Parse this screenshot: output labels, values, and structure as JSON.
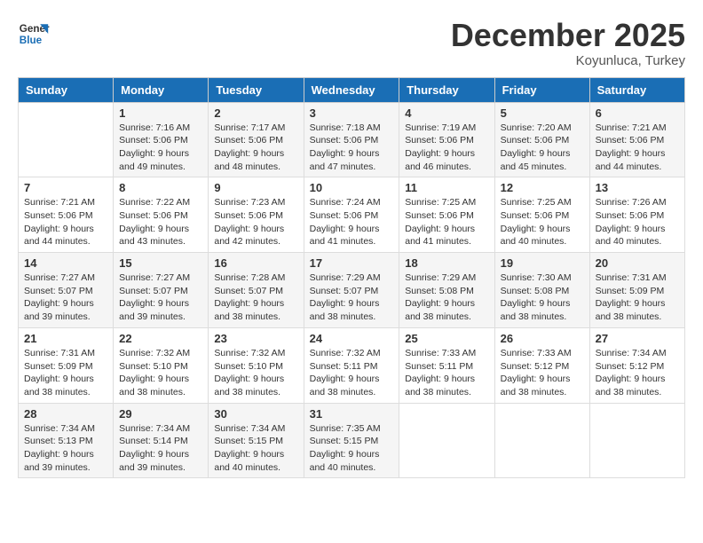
{
  "logo": {
    "line1": "General",
    "line2": "Blue"
  },
  "title": "December 2025",
  "subtitle": "Koyunluca, Turkey",
  "days_header": [
    "Sunday",
    "Monday",
    "Tuesday",
    "Wednesday",
    "Thursday",
    "Friday",
    "Saturday"
  ],
  "weeks": [
    [
      {
        "day": "",
        "info": ""
      },
      {
        "day": "1",
        "info": "Sunrise: 7:16 AM\nSunset: 5:06 PM\nDaylight: 9 hours\nand 49 minutes."
      },
      {
        "day": "2",
        "info": "Sunrise: 7:17 AM\nSunset: 5:06 PM\nDaylight: 9 hours\nand 48 minutes."
      },
      {
        "day": "3",
        "info": "Sunrise: 7:18 AM\nSunset: 5:06 PM\nDaylight: 9 hours\nand 47 minutes."
      },
      {
        "day": "4",
        "info": "Sunrise: 7:19 AM\nSunset: 5:06 PM\nDaylight: 9 hours\nand 46 minutes."
      },
      {
        "day": "5",
        "info": "Sunrise: 7:20 AM\nSunset: 5:06 PM\nDaylight: 9 hours\nand 45 minutes."
      },
      {
        "day": "6",
        "info": "Sunrise: 7:21 AM\nSunset: 5:06 PM\nDaylight: 9 hours\nand 44 minutes."
      }
    ],
    [
      {
        "day": "7",
        "info": "Sunrise: 7:21 AM\nSunset: 5:06 PM\nDaylight: 9 hours\nand 44 minutes."
      },
      {
        "day": "8",
        "info": "Sunrise: 7:22 AM\nSunset: 5:06 PM\nDaylight: 9 hours\nand 43 minutes."
      },
      {
        "day": "9",
        "info": "Sunrise: 7:23 AM\nSunset: 5:06 PM\nDaylight: 9 hours\nand 42 minutes."
      },
      {
        "day": "10",
        "info": "Sunrise: 7:24 AM\nSunset: 5:06 PM\nDaylight: 9 hours\nand 41 minutes."
      },
      {
        "day": "11",
        "info": "Sunrise: 7:25 AM\nSunset: 5:06 PM\nDaylight: 9 hours\nand 41 minutes."
      },
      {
        "day": "12",
        "info": "Sunrise: 7:25 AM\nSunset: 5:06 PM\nDaylight: 9 hours\nand 40 minutes."
      },
      {
        "day": "13",
        "info": "Sunrise: 7:26 AM\nSunset: 5:06 PM\nDaylight: 9 hours\nand 40 minutes."
      }
    ],
    [
      {
        "day": "14",
        "info": "Sunrise: 7:27 AM\nSunset: 5:07 PM\nDaylight: 9 hours\nand 39 minutes."
      },
      {
        "day": "15",
        "info": "Sunrise: 7:27 AM\nSunset: 5:07 PM\nDaylight: 9 hours\nand 39 minutes."
      },
      {
        "day": "16",
        "info": "Sunrise: 7:28 AM\nSunset: 5:07 PM\nDaylight: 9 hours\nand 38 minutes."
      },
      {
        "day": "17",
        "info": "Sunrise: 7:29 AM\nSunset: 5:07 PM\nDaylight: 9 hours\nand 38 minutes."
      },
      {
        "day": "18",
        "info": "Sunrise: 7:29 AM\nSunset: 5:08 PM\nDaylight: 9 hours\nand 38 minutes."
      },
      {
        "day": "19",
        "info": "Sunrise: 7:30 AM\nSunset: 5:08 PM\nDaylight: 9 hours\nand 38 minutes."
      },
      {
        "day": "20",
        "info": "Sunrise: 7:31 AM\nSunset: 5:09 PM\nDaylight: 9 hours\nand 38 minutes."
      }
    ],
    [
      {
        "day": "21",
        "info": "Sunrise: 7:31 AM\nSunset: 5:09 PM\nDaylight: 9 hours\nand 38 minutes."
      },
      {
        "day": "22",
        "info": "Sunrise: 7:32 AM\nSunset: 5:10 PM\nDaylight: 9 hours\nand 38 minutes."
      },
      {
        "day": "23",
        "info": "Sunrise: 7:32 AM\nSunset: 5:10 PM\nDaylight: 9 hours\nand 38 minutes."
      },
      {
        "day": "24",
        "info": "Sunrise: 7:32 AM\nSunset: 5:11 PM\nDaylight: 9 hours\nand 38 minutes."
      },
      {
        "day": "25",
        "info": "Sunrise: 7:33 AM\nSunset: 5:11 PM\nDaylight: 9 hours\nand 38 minutes."
      },
      {
        "day": "26",
        "info": "Sunrise: 7:33 AM\nSunset: 5:12 PM\nDaylight: 9 hours\nand 38 minutes."
      },
      {
        "day": "27",
        "info": "Sunrise: 7:34 AM\nSunset: 5:12 PM\nDaylight: 9 hours\nand 38 minutes."
      }
    ],
    [
      {
        "day": "28",
        "info": "Sunrise: 7:34 AM\nSunset: 5:13 PM\nDaylight: 9 hours\nand 39 minutes."
      },
      {
        "day": "29",
        "info": "Sunrise: 7:34 AM\nSunset: 5:14 PM\nDaylight: 9 hours\nand 39 minutes."
      },
      {
        "day": "30",
        "info": "Sunrise: 7:34 AM\nSunset: 5:15 PM\nDaylight: 9 hours\nand 40 minutes."
      },
      {
        "day": "31",
        "info": "Sunrise: 7:35 AM\nSunset: 5:15 PM\nDaylight: 9 hours\nand 40 minutes."
      },
      {
        "day": "",
        "info": ""
      },
      {
        "day": "",
        "info": ""
      },
      {
        "day": "",
        "info": ""
      }
    ]
  ]
}
